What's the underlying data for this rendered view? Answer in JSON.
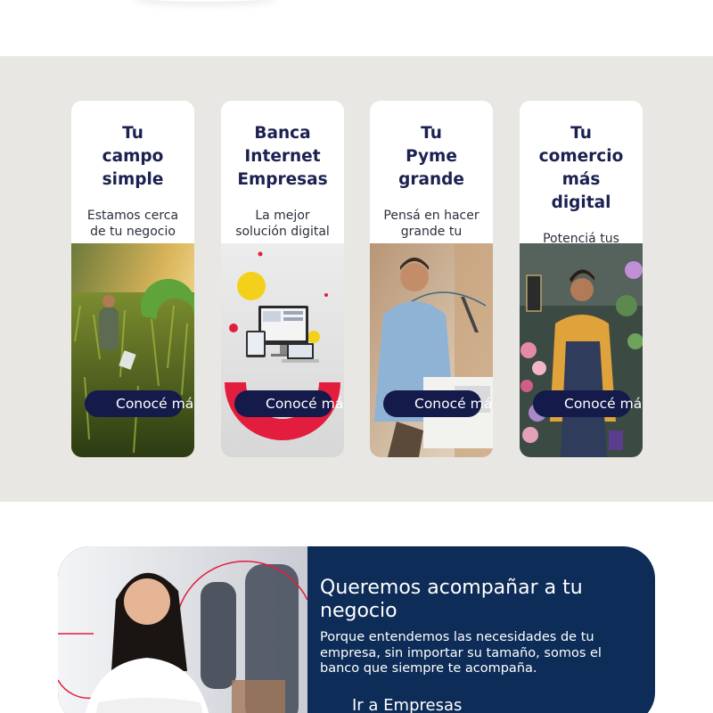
{
  "cards": [
    {
      "title": [
        "Tu",
        "campo",
        "simple"
      ],
      "description": "Estamos cerca de tu negocio",
      "button_label": "Conocé más"
    },
    {
      "title": [
        "Banca",
        "Internet",
        "Empresas"
      ],
      "description": "La mejor solución digital",
      "button_label": "Conocé más"
    },
    {
      "title": [
        "Tu",
        "Pyme",
        "grande"
      ],
      "description": "Pensá en hacer grande tu",
      "button_label": "Conocé más"
    },
    {
      "title": [
        "Tu",
        "comercio",
        "más",
        "digital"
      ],
      "description": "Potenciá tus",
      "button_label": "Conocé más"
    }
  ],
  "promo": {
    "title": "Queremos acompañar a tu negocio",
    "body": "Porque entendemos las necesidades de tu empresa, sin importar su tamaño, somos el banco que siempre te acompaña.",
    "button_label": "Ir a Empresas"
  },
  "colors": {
    "section_bg": "#e9e7e4",
    "button_navy": "#141a4a",
    "promo_bg": "#0d2c57",
    "accent_red": "#e31d3d",
    "accent_green": "#5fa33b"
  }
}
